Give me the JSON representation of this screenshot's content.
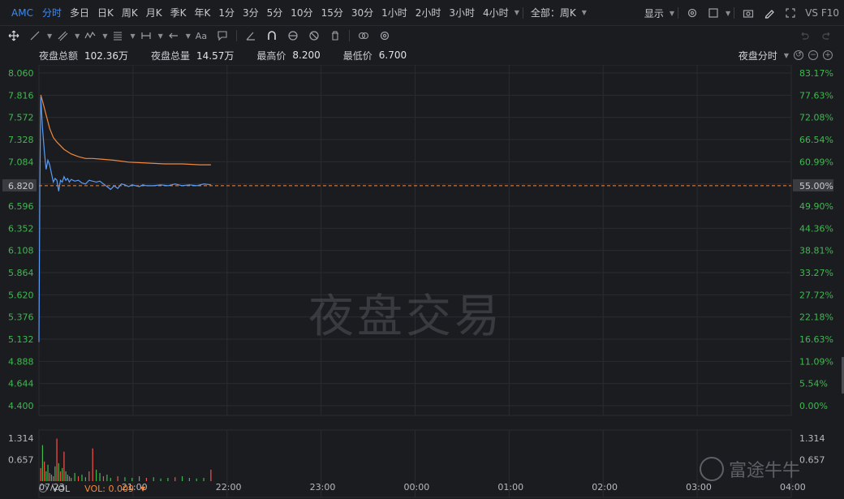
{
  "toolbar": {
    "symbol": "AMC",
    "periods": [
      "分时",
      "多日",
      "日K",
      "周K",
      "月K",
      "季K",
      "年K",
      "1分",
      "3分",
      "5分",
      "10分",
      "15分",
      "30分",
      "1小时",
      "2小时",
      "3小时",
      "4小时"
    ],
    "active_period": "分时",
    "scope_label": "全部：周K",
    "display_label": "显示",
    "compare_label": "VS F10"
  },
  "stats": {
    "night_amount_label": "夜盘总额",
    "night_amount_value": "102.36万",
    "night_volume_label": "夜盘总量",
    "night_volume_value": "14.57万",
    "high_label": "最高价",
    "high_value": "8.200",
    "low_label": "最低价",
    "low_value": "6.700",
    "session_label": "夜盘分时"
  },
  "watermark": "夜盘交易",
  "logo_text": "富途牛牛",
  "colors": {
    "price_line": "#5b9cf5",
    "avg_line": "#f0883e",
    "up": "#3fb950",
    "down": "#f85149",
    "accent": "#3d8bf2"
  },
  "chart_data": {
    "type": "line",
    "left_axis_ticks": [
      "8.060",
      "7.816",
      "7.572",
      "7.328",
      "7.084",
      "6.820",
      "6.596",
      "6.352",
      "6.108",
      "5.864",
      "5.620",
      "5.376",
      "5.132",
      "4.888",
      "4.644",
      "4.400"
    ],
    "right_axis_ticks": [
      "83.17%",
      "77.63%",
      "72.08%",
      "66.54%",
      "60.99%",
      "55.00%",
      "49.90%",
      "44.36%",
      "38.81%",
      "33.27%",
      "27.72%",
      "22.18%",
      "16.63%",
      "11.09%",
      "5.54%",
      "0.00%"
    ],
    "ylim": [
      4.4,
      8.06
    ],
    "prev_close": 6.82,
    "x_ticks": [
      "07/23",
      "21:00",
      "22:00",
      "23:00",
      "00:00",
      "01:00",
      "02:00",
      "03:00",
      "04:00"
    ],
    "x_range_minutes": [
      0,
      420
    ],
    "series": [
      {
        "key": "price",
        "points": [
          [
            0,
            5.1
          ],
          [
            0.5,
            6.82
          ],
          [
            1,
            7.8
          ],
          [
            2,
            7.45
          ],
          [
            3,
            7.2
          ],
          [
            4,
            7.0
          ],
          [
            5,
            7.1
          ],
          [
            6,
            7.05
          ],
          [
            7,
            6.95
          ],
          [
            8,
            6.86
          ],
          [
            9,
            6.9
          ],
          [
            10,
            6.88
          ],
          [
            11,
            6.76
          ],
          [
            12,
            6.88
          ],
          [
            13,
            6.86
          ],
          [
            14,
            6.92
          ],
          [
            15,
            6.88
          ],
          [
            16,
            6.9
          ],
          [
            17,
            6.86
          ],
          [
            18,
            6.89
          ],
          [
            20,
            6.87
          ],
          [
            22,
            6.88
          ],
          [
            24,
            6.85
          ],
          [
            26,
            6.84
          ],
          [
            28,
            6.88
          ],
          [
            30,
            6.87
          ],
          [
            32,
            6.86
          ],
          [
            34,
            6.87
          ],
          [
            36,
            6.84
          ],
          [
            38,
            6.81
          ],
          [
            40,
            6.78
          ],
          [
            42,
            6.82
          ],
          [
            44,
            6.79
          ],
          [
            46,
            6.84
          ],
          [
            48,
            6.83
          ],
          [
            50,
            6.81
          ],
          [
            52,
            6.83
          ],
          [
            54,
            6.82
          ],
          [
            56,
            6.81
          ],
          [
            58,
            6.83
          ],
          [
            60,
            6.82
          ],
          [
            64,
            6.82
          ],
          [
            68,
            6.83
          ],
          [
            72,
            6.82
          ],
          [
            76,
            6.84
          ],
          [
            80,
            6.82
          ],
          [
            84,
            6.83
          ],
          [
            88,
            6.82
          ],
          [
            92,
            6.84
          ],
          [
            96,
            6.83
          ]
        ]
      },
      {
        "key": "average",
        "points": [
          [
            1,
            7.82
          ],
          [
            2,
            7.75
          ],
          [
            4,
            7.6
          ],
          [
            6,
            7.45
          ],
          [
            8,
            7.35
          ],
          [
            10,
            7.3
          ],
          [
            14,
            7.22
          ],
          [
            18,
            7.17
          ],
          [
            22,
            7.14
          ],
          [
            26,
            7.12
          ],
          [
            30,
            7.12
          ],
          [
            36,
            7.11
          ],
          [
            42,
            7.1
          ],
          [
            50,
            7.08
          ],
          [
            60,
            7.07
          ],
          [
            70,
            7.06
          ],
          [
            80,
            7.06
          ],
          [
            90,
            7.05
          ],
          [
            96,
            7.05
          ]
        ]
      }
    ],
    "volume": {
      "label": "VOL",
      "value_label": "VOL: 0.009",
      "ticks": [
        "1.314",
        "0.657"
      ],
      "ylim": [
        0,
        1.314
      ],
      "bars": [
        [
          1,
          0.4,
          "down"
        ],
        [
          2,
          1.1,
          "up"
        ],
        [
          3,
          0.6,
          "down"
        ],
        [
          4,
          0.3,
          "up"
        ],
        [
          5,
          0.5,
          "up"
        ],
        [
          6,
          0.25,
          "down"
        ],
        [
          7,
          0.2,
          "up"
        ],
        [
          8,
          0.15,
          "down"
        ],
        [
          9,
          0.45,
          "up"
        ],
        [
          10,
          1.3,
          "down"
        ],
        [
          11,
          0.55,
          "up"
        ],
        [
          12,
          0.3,
          "down"
        ],
        [
          13,
          0.4,
          "up"
        ],
        [
          14,
          0.9,
          "down"
        ],
        [
          15,
          0.3,
          "up"
        ],
        [
          16,
          0.2,
          "up"
        ],
        [
          17,
          0.15,
          "down"
        ],
        [
          18,
          0.1,
          "up"
        ],
        [
          20,
          0.25,
          "up"
        ],
        [
          22,
          0.15,
          "down"
        ],
        [
          24,
          0.2,
          "up"
        ],
        [
          26,
          0.12,
          "up"
        ],
        [
          28,
          0.3,
          "down"
        ],
        [
          30,
          1.0,
          "down"
        ],
        [
          32,
          0.35,
          "up"
        ],
        [
          34,
          0.25,
          "up"
        ],
        [
          36,
          0.15,
          "down"
        ],
        [
          38,
          0.2,
          "up"
        ],
        [
          40,
          0.1,
          "up"
        ],
        [
          44,
          0.15,
          "down"
        ],
        [
          48,
          0.12,
          "up"
        ],
        [
          52,
          0.1,
          "up"
        ],
        [
          56,
          0.15,
          "up"
        ],
        [
          60,
          0.1,
          "down"
        ],
        [
          64,
          0.12,
          "up"
        ],
        [
          68,
          0.08,
          "up"
        ],
        [
          72,
          0.1,
          "up"
        ],
        [
          76,
          0.12,
          "down"
        ],
        [
          80,
          0.15,
          "up"
        ],
        [
          84,
          0.1,
          "up"
        ],
        [
          88,
          0.08,
          "up"
        ],
        [
          92,
          0.1,
          "up"
        ],
        [
          96,
          0.35,
          "down"
        ]
      ]
    }
  }
}
